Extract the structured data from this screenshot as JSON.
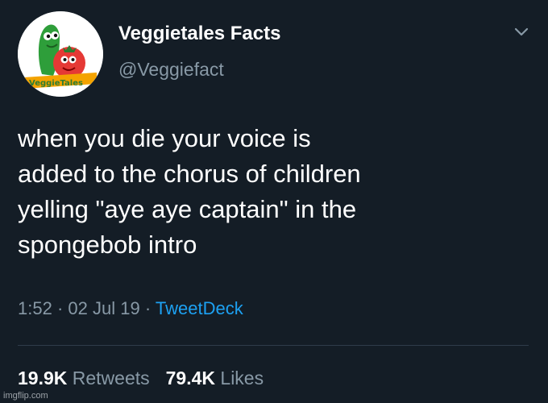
{
  "tweet": {
    "display_name": "Veggietales Facts",
    "handle": "@Veggiefact",
    "avatar_logo_text": "VeggieTales",
    "text_lines": [
      "when you die your voice is",
      "added to the chorus of children",
      "yelling \"aye aye captain\" in the",
      "spongebob intro"
    ],
    "time": "1:52",
    "separator": "·",
    "date": "02 Jul 19",
    "source": "TweetDeck",
    "retweets_count": "19.9K",
    "retweets_label": "Retweets",
    "likes_count": "79.4K",
    "likes_label": "Likes"
  },
  "watermark": "imgflip.com",
  "colors": {
    "background": "#141d26",
    "text_primary": "#ffffff",
    "text_secondary": "#8899a6",
    "link": "#1da1f2"
  },
  "icons": {
    "caret": "chevron-down-icon"
  }
}
